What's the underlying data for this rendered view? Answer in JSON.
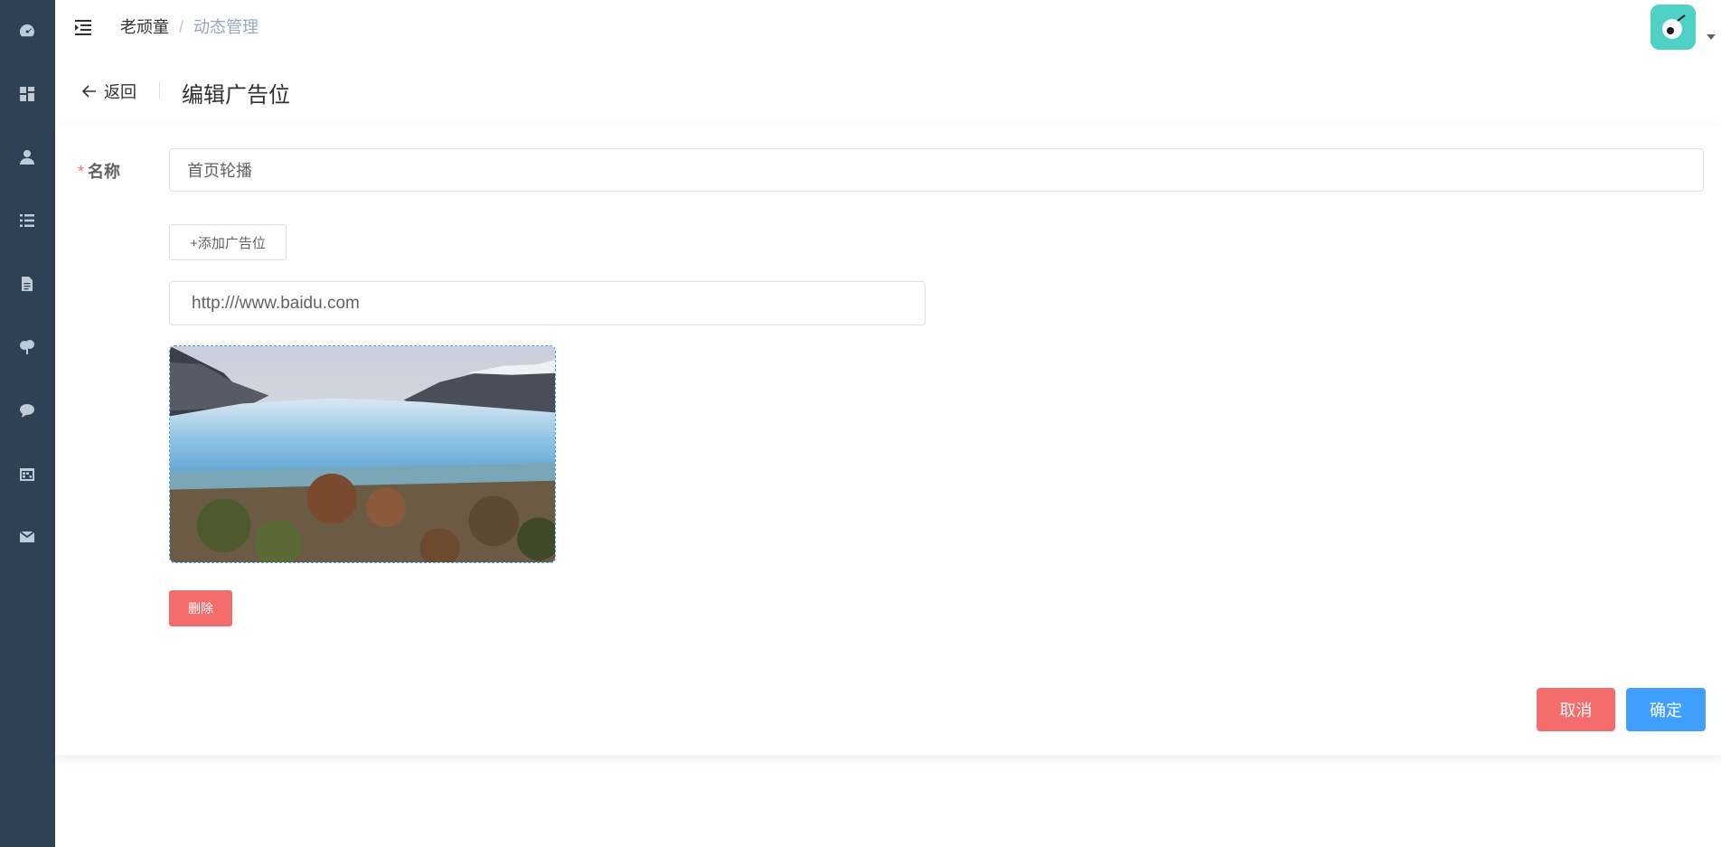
{
  "sidebar": {
    "items": [
      {
        "icon": "dashboard-icon"
      },
      {
        "icon": "grid-icon"
      },
      {
        "icon": "user-icon"
      },
      {
        "icon": "list-icon"
      },
      {
        "icon": "document-icon"
      },
      {
        "icon": "tree-icon"
      },
      {
        "icon": "chat-icon"
      },
      {
        "icon": "calendar-icon"
      },
      {
        "icon": "mail-icon"
      }
    ]
  },
  "navbar": {
    "breadcrumb": [
      "老顽童",
      "动态管理"
    ],
    "separator": "/"
  },
  "page_header": {
    "back_label": "返回",
    "title": "编辑广告位"
  },
  "form": {
    "name_label": "名称",
    "required_mark": "*",
    "name_value": "首页轮播",
    "add_button": "+添加广告位",
    "url_value": "http:///www.baidu.com",
    "delete_button": "删除",
    "cancel_button": "取消",
    "confirm_button": "确定"
  },
  "colors": {
    "sidebar": "#304156",
    "danger": "#f56c6c",
    "primary": "#409eff",
    "avatar": "#4fd1c5"
  }
}
